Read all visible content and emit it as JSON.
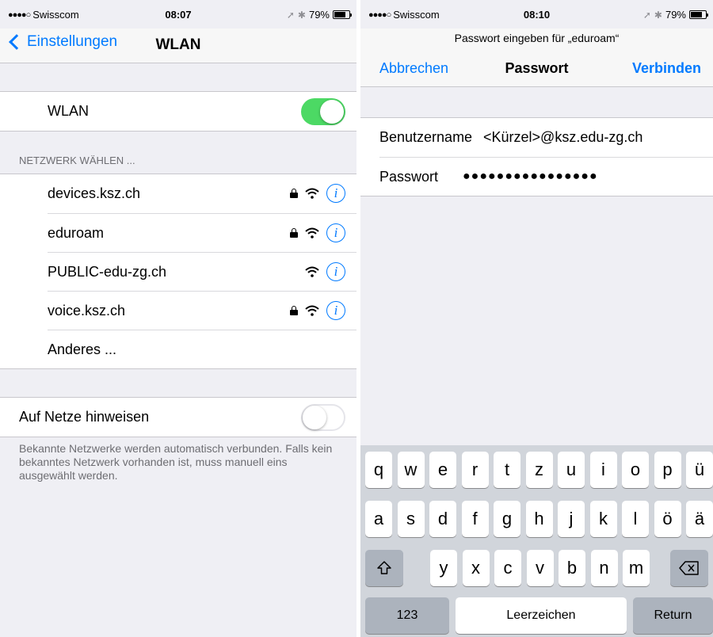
{
  "left": {
    "status": {
      "carrier": "Swisscom",
      "signal_dots": "●●●●○",
      "time": "08:07",
      "battery": "79%",
      "battery_level": 0.79
    },
    "nav": {
      "back_label": "Einstellungen",
      "title": "WLAN"
    },
    "wlan_row": {
      "label": "WLAN",
      "toggle_on": true
    },
    "networks_header": "NETZWERK WÄHLEN ...",
    "networks": [
      {
        "name": "devices.ksz.ch",
        "locked": true
      },
      {
        "name": "eduroam",
        "locked": true
      },
      {
        "name": "PUBLIC-edu-zg.ch",
        "locked": false
      },
      {
        "name": "voice.ksz.ch",
        "locked": true
      }
    ],
    "other_label": "Anderes ...",
    "ask_row": {
      "label": "Auf Netze hinweisen",
      "toggle_on": false
    },
    "footer": "Bekannte Netzwerke werden automatisch verbunden. Falls kein bekanntes Netzwerk vorhanden ist, muss manuell eins ausgewählt werden."
  },
  "right": {
    "status": {
      "carrier": "Swisscom",
      "signal_dots": "●●●●○",
      "time": "08:10",
      "battery": "79%",
      "battery_level": 0.79
    },
    "prompt": "Passwort eingeben für „eduroam“",
    "cancel_label": "Abbrechen",
    "title": "Passwort",
    "connect_label": "Verbinden",
    "username_label": "Benutzername",
    "username_value": "<Kürzel>@ksz.edu-zg.ch",
    "password_label": "Passwort",
    "password_value": "●●●●●●●●●●●●●●●●",
    "keyboard": {
      "row1": [
        "q",
        "w",
        "e",
        "r",
        "t",
        "z",
        "u",
        "i",
        "o",
        "p",
        "ü"
      ],
      "row2": [
        "a",
        "s",
        "d",
        "f",
        "g",
        "h",
        "j",
        "k",
        "l",
        "ö",
        "ä"
      ],
      "row3": [
        "y",
        "x",
        "c",
        "v",
        "b",
        "n",
        "m"
      ],
      "numbers_label": "123",
      "space_label": "Leerzeichen",
      "return_label": "Return"
    }
  },
  "colors": {
    "accent": "#007aff",
    "toggle_on": "#4cd964",
    "background": "#efeff4"
  },
  "icons": [
    "location-icon",
    "bluetooth-icon",
    "battery-icon",
    "lock-icon",
    "wifi-icon",
    "info-icon",
    "shift-icon",
    "backspace-icon"
  ]
}
